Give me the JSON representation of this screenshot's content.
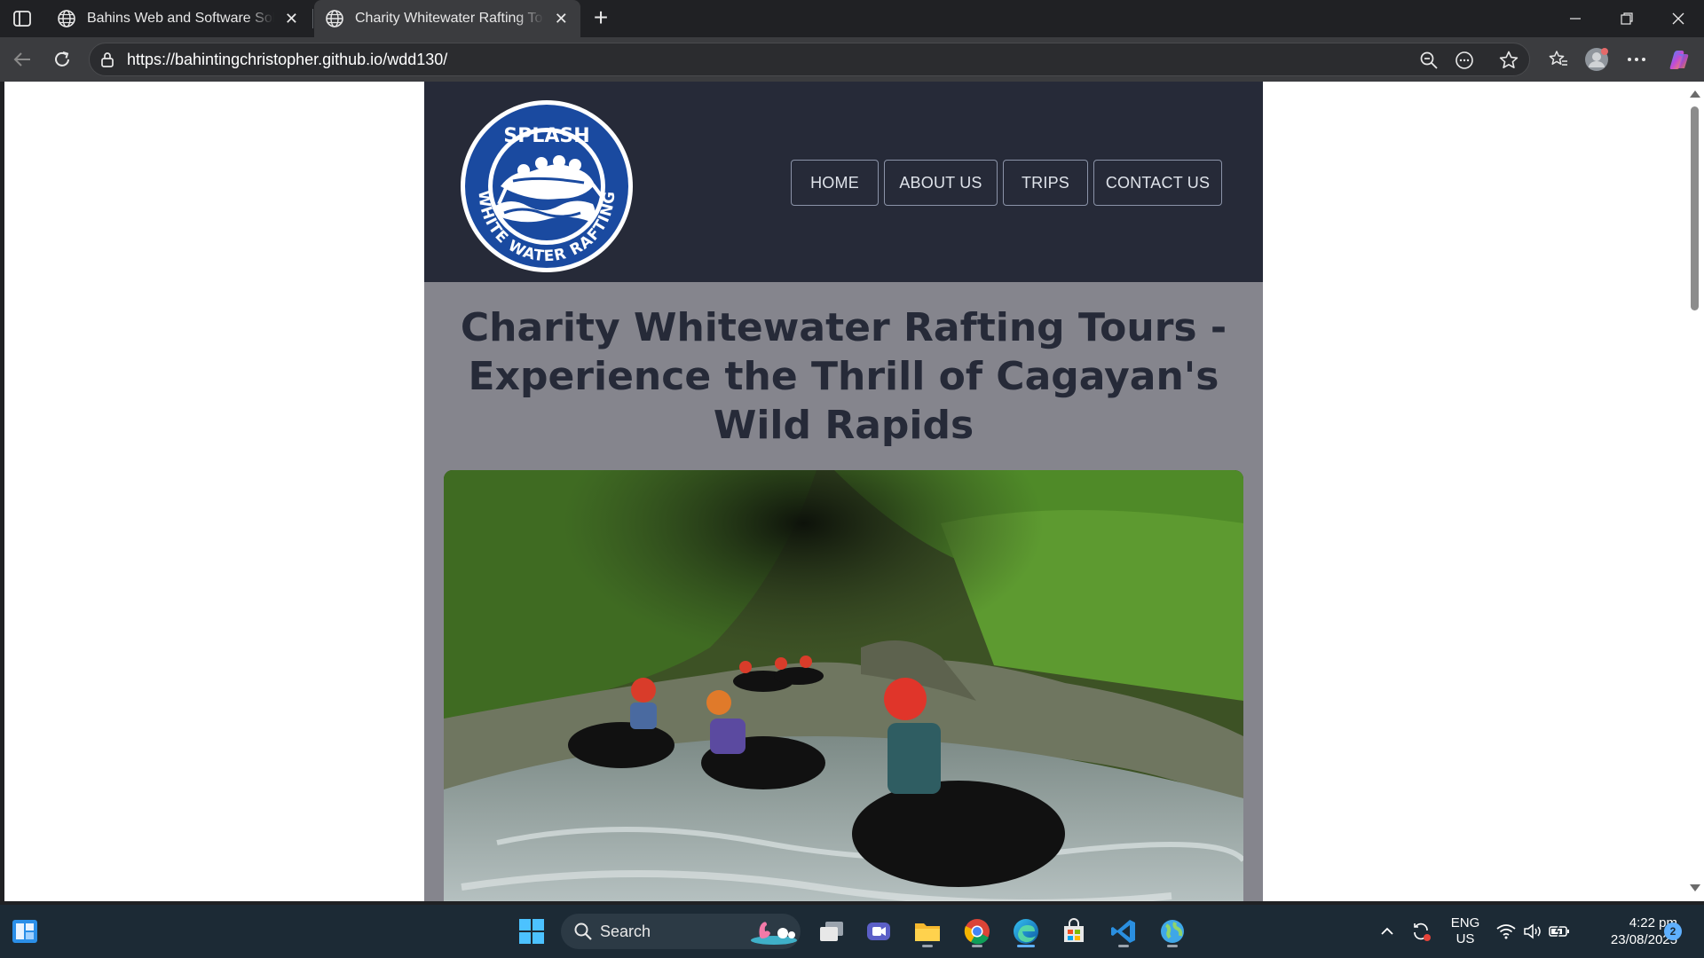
{
  "browser": {
    "tabs": [
      {
        "title": "Bahins Web and Software Solutions",
        "active": false
      },
      {
        "title": "Charity Whitewater Rafting Tours",
        "active": true
      }
    ],
    "url": "https://bahintingchristopher.github.io/wdd130/"
  },
  "site": {
    "logo": {
      "top_text": "SPLASH",
      "ring_text": "WHITE WATER RAFTING"
    },
    "nav": [
      "HOME",
      "ABOUT US",
      "TRIPS",
      "CONTACT US"
    ],
    "headline": "Charity Whitewater Rafting Tours - Experience the Thrill of Cagayan's Wild Rapids",
    "colors": {
      "header_bg": "#262a38",
      "page_bg": "#85858d",
      "heading": "#262a38"
    }
  },
  "taskbar": {
    "search_label": "Search",
    "lang_line1": "ENG",
    "lang_line2": "US",
    "time": "4:22 pm",
    "date": "23/08/2025",
    "notification_count": "2"
  }
}
